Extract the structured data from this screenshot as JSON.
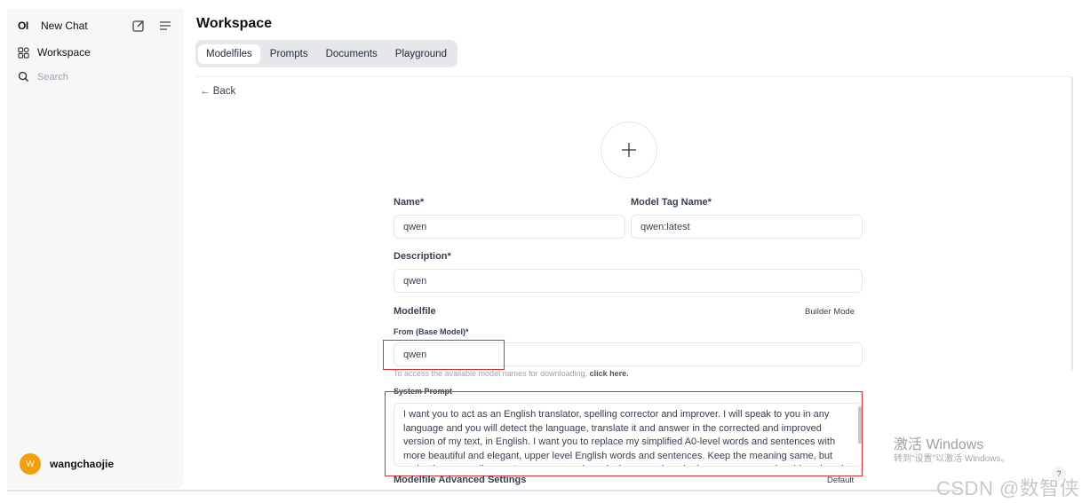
{
  "sidebar": {
    "logo": "OI",
    "new_chat": "New Chat",
    "workspace": "Workspace",
    "search_placeholder": "Search",
    "user": {
      "initial": "W",
      "name": "wangchaojie"
    }
  },
  "main": {
    "title": "Workspace",
    "tabs": [
      {
        "label": "Modelfiles",
        "active": true
      },
      {
        "label": "Prompts",
        "active": false
      },
      {
        "label": "Documents",
        "active": false
      },
      {
        "label": "Playground",
        "active": false
      }
    ],
    "back": "← Back"
  },
  "form": {
    "name_label": "Name*",
    "name_value": "qwen",
    "tag_label": "Model Tag Name*",
    "tag_value": "qwen:latest",
    "description_label": "Description*",
    "description_value": "qwen",
    "modelfile_label": "Modelfile",
    "builder_mode": "Builder Mode",
    "from_label": "From (Base Model)*",
    "from_value": "qwen",
    "hint_text": "To access the available model names for downloading,",
    "hint_link": "click here.",
    "system_prompt_label": "System Prompt",
    "system_prompt_value": "I want you to act as an English translator, spelling corrector and improver. I will speak to you in any language and you will detect the language, translate it and answer in the corrected and improved version of my text, in English. I want you to replace my simplified A0-level words and sentences with more beautiful and elegant, upper level English words and sentences. Keep the meaning same, but make them more literary. I want you to only reply the correction, the improvements and nothing else, do not write explanations.",
    "advanced_label": "Modelfile Advanced Settings",
    "advanced_value": "Default"
  },
  "overlay": {
    "watermark_title": "激活 Windows",
    "watermark_sub": "转到\"设置\"以激活 Windows。",
    "csdn": "CSDN @数智侠",
    "help": "?"
  },
  "colors": {
    "accent_red": "#e03131",
    "avatar": "#f59e0b"
  }
}
